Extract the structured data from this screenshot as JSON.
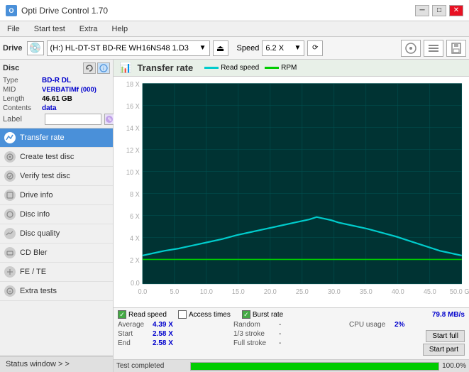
{
  "titlebar": {
    "title": "Opti Drive Control 1.70",
    "controls": [
      "minimize",
      "maximize",
      "close"
    ]
  },
  "menubar": {
    "items": [
      "File",
      "Start test",
      "Extra",
      "Help"
    ]
  },
  "toolbar": {
    "drive_label": "Drive",
    "drive_icon": "💿",
    "drive_value": "(H:)  HL-DT-ST BD-RE  WH16NS48 1.D3",
    "speed_label": "Speed",
    "speed_value": "6.2 X"
  },
  "disc": {
    "label": "Disc",
    "type_key": "Type",
    "type_val": "BD-R DL",
    "mid_key": "MID",
    "mid_val": "VERBATIMf (000)",
    "length_key": "Length",
    "length_val": "46.61 GB",
    "contents_key": "Contents",
    "contents_val": "data",
    "label_key": "Label",
    "label_val": ""
  },
  "nav": {
    "items": [
      {
        "id": "transfer-rate",
        "label": "Transfer rate",
        "active": true
      },
      {
        "id": "create-test-disc",
        "label": "Create test disc",
        "active": false
      },
      {
        "id": "verify-test-disc",
        "label": "Verify test disc",
        "active": false
      },
      {
        "id": "drive-info",
        "label": "Drive info",
        "active": false
      },
      {
        "id": "disc-info",
        "label": "Disc info",
        "active": false
      },
      {
        "id": "disc-quality",
        "label": "Disc quality",
        "active": false
      },
      {
        "id": "cd-bler",
        "label": "CD Bler",
        "active": false
      },
      {
        "id": "fe-te",
        "label": "FE / TE",
        "active": false
      },
      {
        "id": "extra-tests",
        "label": "Extra tests",
        "active": false
      }
    ]
  },
  "status_window": "Status window > >",
  "chart": {
    "title": "Transfer rate",
    "legend_read": "Read speed",
    "legend_rpm": "RPM",
    "y_labels": [
      "18 X",
      "16 X",
      "14 X",
      "12 X",
      "10 X",
      "8 X",
      "6 X",
      "4 X",
      "2 X",
      "0.0"
    ],
    "x_labels": [
      "0.0",
      "5.0",
      "10.0",
      "15.0",
      "20.0",
      "25.0",
      "30.0",
      "35.0",
      "40.0",
      "45.0",
      "50.0 GB"
    ]
  },
  "checkboxes": {
    "read_speed": {
      "label": "Read speed",
      "checked": true
    },
    "access_times": {
      "label": "Access times",
      "checked": false
    },
    "burst_rate": {
      "label": "Burst rate",
      "checked": true
    }
  },
  "burst_rate_val": "79.8 MB/s",
  "stats": {
    "average_key": "Average",
    "average_val": "4.39 X",
    "start_key": "Start",
    "start_val": "2.58 X",
    "end_key": "End",
    "end_val": "2.58 X",
    "random_key": "Random",
    "random_val": "-",
    "stroke1_key": "1/3 stroke",
    "stroke1_val": "-",
    "stroke2_key": "Full stroke",
    "stroke2_val": "-",
    "cpu_key": "CPU usage",
    "cpu_val": "2%"
  },
  "buttons": {
    "start_full": "Start full",
    "start_part": "Start part"
  },
  "progress": {
    "status": "Test completed",
    "percent": 100,
    "percent_label": "100.0%"
  }
}
